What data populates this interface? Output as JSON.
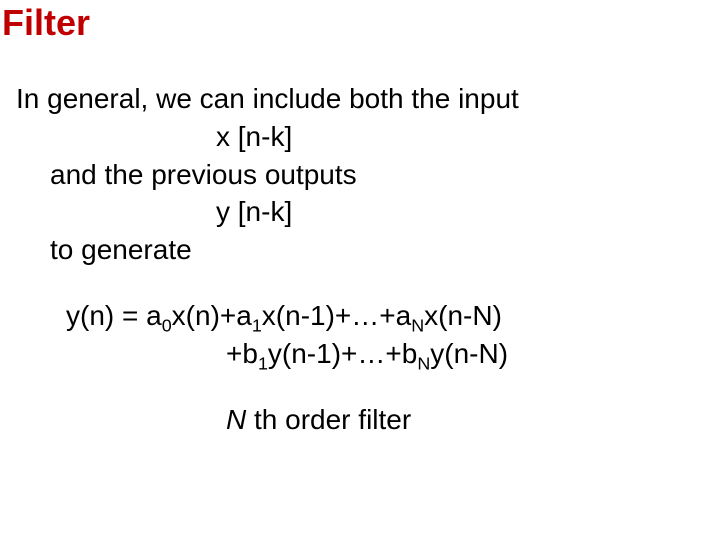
{
  "title": "Filter",
  "body": {
    "line1": "In general, we can include both the input",
    "x_expr": "x [n-k]",
    "line2": "and the previous outputs",
    "y_expr": "y [n-k]",
    "line3": "to generate"
  },
  "equation": {
    "lhs": "y(n) = a",
    "a0_sub": "0",
    "a1_pre": "x(n)+a",
    "a1_sub": "1",
    "aN_pre": "x(n-1)+…+a",
    "aN_sub": "N",
    "aN_post": "x(n-N)",
    "b1_pre": "+b",
    "b1_sub": "1",
    "bN_pre": "y(n-1)+…+b",
    "bN_sub": "N",
    "bN_post": "y(n-N)"
  },
  "order": {
    "n_letter": "N",
    "rest": " th order filter"
  }
}
